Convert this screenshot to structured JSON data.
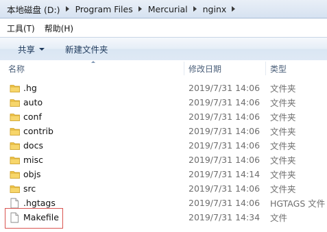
{
  "address_bar": {
    "crumbs": [
      "本地磁盘 (D:)",
      "Program Files",
      "Mercurial",
      "nginx"
    ]
  },
  "menu": {
    "items": [
      "工具(T)",
      "帮助(H)"
    ]
  },
  "toolbar": {
    "share_label": "共享",
    "new_folder_label": "新建文件夹"
  },
  "columns": {
    "name": "名称",
    "date": "修改日期",
    "type": "类型"
  },
  "files": [
    {
      "name": ".hg",
      "date": "2019/7/31 14:06",
      "type": "文件夹",
      "icon": "folder-icon"
    },
    {
      "name": "auto",
      "date": "2019/7/31 14:06",
      "type": "文件夹",
      "icon": "folder-icon"
    },
    {
      "name": "conf",
      "date": "2019/7/31 14:06",
      "type": "文件夹",
      "icon": "folder-icon"
    },
    {
      "name": "contrib",
      "date": "2019/7/31 14:06",
      "type": "文件夹",
      "icon": "folder-icon"
    },
    {
      "name": "docs",
      "date": "2019/7/31 14:06",
      "type": "文件夹",
      "icon": "folder-icon"
    },
    {
      "name": "misc",
      "date": "2019/7/31 14:06",
      "type": "文件夹",
      "icon": "folder-icon"
    },
    {
      "name": "objs",
      "date": "2019/7/31 14:14",
      "type": "文件夹",
      "icon": "folder-icon"
    },
    {
      "name": "src",
      "date": "2019/7/31 14:06",
      "type": "文件夹",
      "icon": "folder-icon"
    },
    {
      "name": ".hgtags",
      "date": "2019/7/31 14:06",
      "type": "HGTAGS 文件",
      "icon": "file-icon"
    },
    {
      "name": "Makefile",
      "date": "2019/7/31 14:34",
      "type": "文件",
      "icon": "file-icon"
    }
  ],
  "colors": {
    "folder_yellow": "#f4c84a",
    "highlight_border": "#d9534f"
  }
}
